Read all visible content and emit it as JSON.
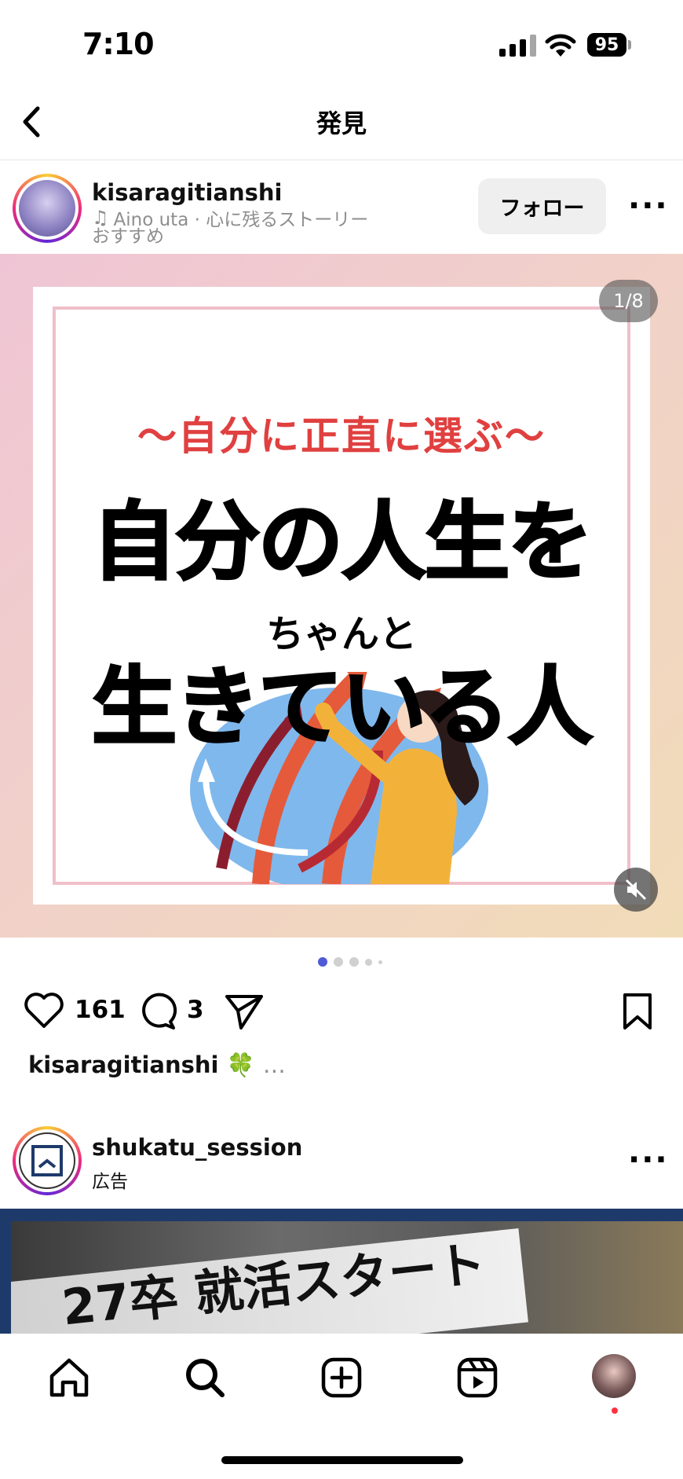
{
  "status_bar": {
    "time": "7:10",
    "battery": "95"
  },
  "header": {
    "title": "発見"
  },
  "post": {
    "username": "kisaragitianshi",
    "music": "Aino uta · 心に残るストーリー",
    "label": "おすすめ",
    "follow_label": "フォロー",
    "counter": "1/8",
    "image_text": {
      "subtitle": "〜自分に正直に選ぶ〜",
      "line1": "自分の人生を",
      "small": "ちゃんと",
      "line2": "生きている人"
    },
    "likes": "161",
    "comments": "3",
    "caption_user": "kisaragitianshi",
    "caption_emoji": "🍀",
    "caption_more": "…"
  },
  "ad": {
    "username": "shukatu_session",
    "label": "広告",
    "banner_text": "27卒 就活スタート"
  },
  "nav": {
    "items": [
      "home-icon",
      "search-icon",
      "create-icon",
      "reels-icon",
      "profile-avatar"
    ]
  },
  "colors": {
    "accent_dot": "#4f5bd5",
    "notify": "#ff3040",
    "title_red": "#e04040"
  }
}
